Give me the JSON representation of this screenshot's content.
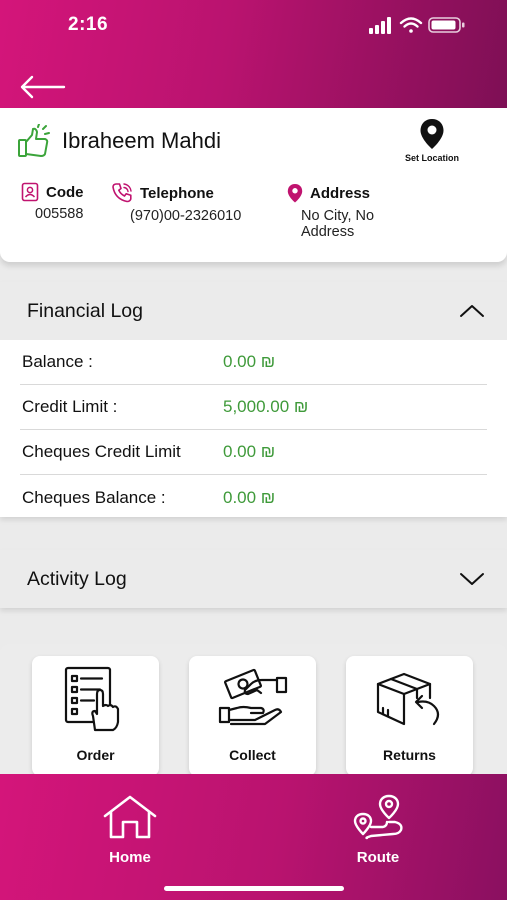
{
  "status_bar": {
    "time": "2:16"
  },
  "customer": {
    "name": "Ibraheem Mahdi",
    "set_location_label": "Set Location",
    "code_label": "Code",
    "code_value": "005588",
    "telephone_label": "Telephone",
    "telephone_value": "(970)00-2326010",
    "address_label": "Address",
    "address_value": "No City, No Address"
  },
  "financial_log": {
    "title": "Financial Log",
    "rows": [
      {
        "label": "Balance :",
        "value": "0.00 ₪"
      },
      {
        "label": "Credit Limit :",
        "value": "5,000.00 ₪"
      },
      {
        "label": "Cheques Credit Limit",
        "value": "0.00 ₪"
      },
      {
        "label": "Cheques Balance :",
        "value": "0.00 ₪"
      }
    ]
  },
  "activity_log": {
    "title": "Activity Log"
  },
  "actions": {
    "order": "Order",
    "collect": "Collect",
    "returns": "Returns"
  },
  "bottom_nav": {
    "home": "Home",
    "route": "Route"
  },
  "colors": {
    "brand": "#c4137a",
    "brand_dark": "#7e0f55",
    "value_green": "#3f9a3a",
    "thumb_green": "#3ba43a",
    "pin_magenta": "#c0136f"
  },
  "icons": [
    "back-arrow-icon",
    "thumbs-up-icon",
    "map-pin-icon",
    "id-card-icon",
    "phone-icon",
    "location-pin-icon",
    "chevron-up-icon",
    "chevron-down-icon",
    "order-clipboard-icon",
    "collect-money-icon",
    "returns-box-icon",
    "home-icon",
    "route-icon"
  ]
}
